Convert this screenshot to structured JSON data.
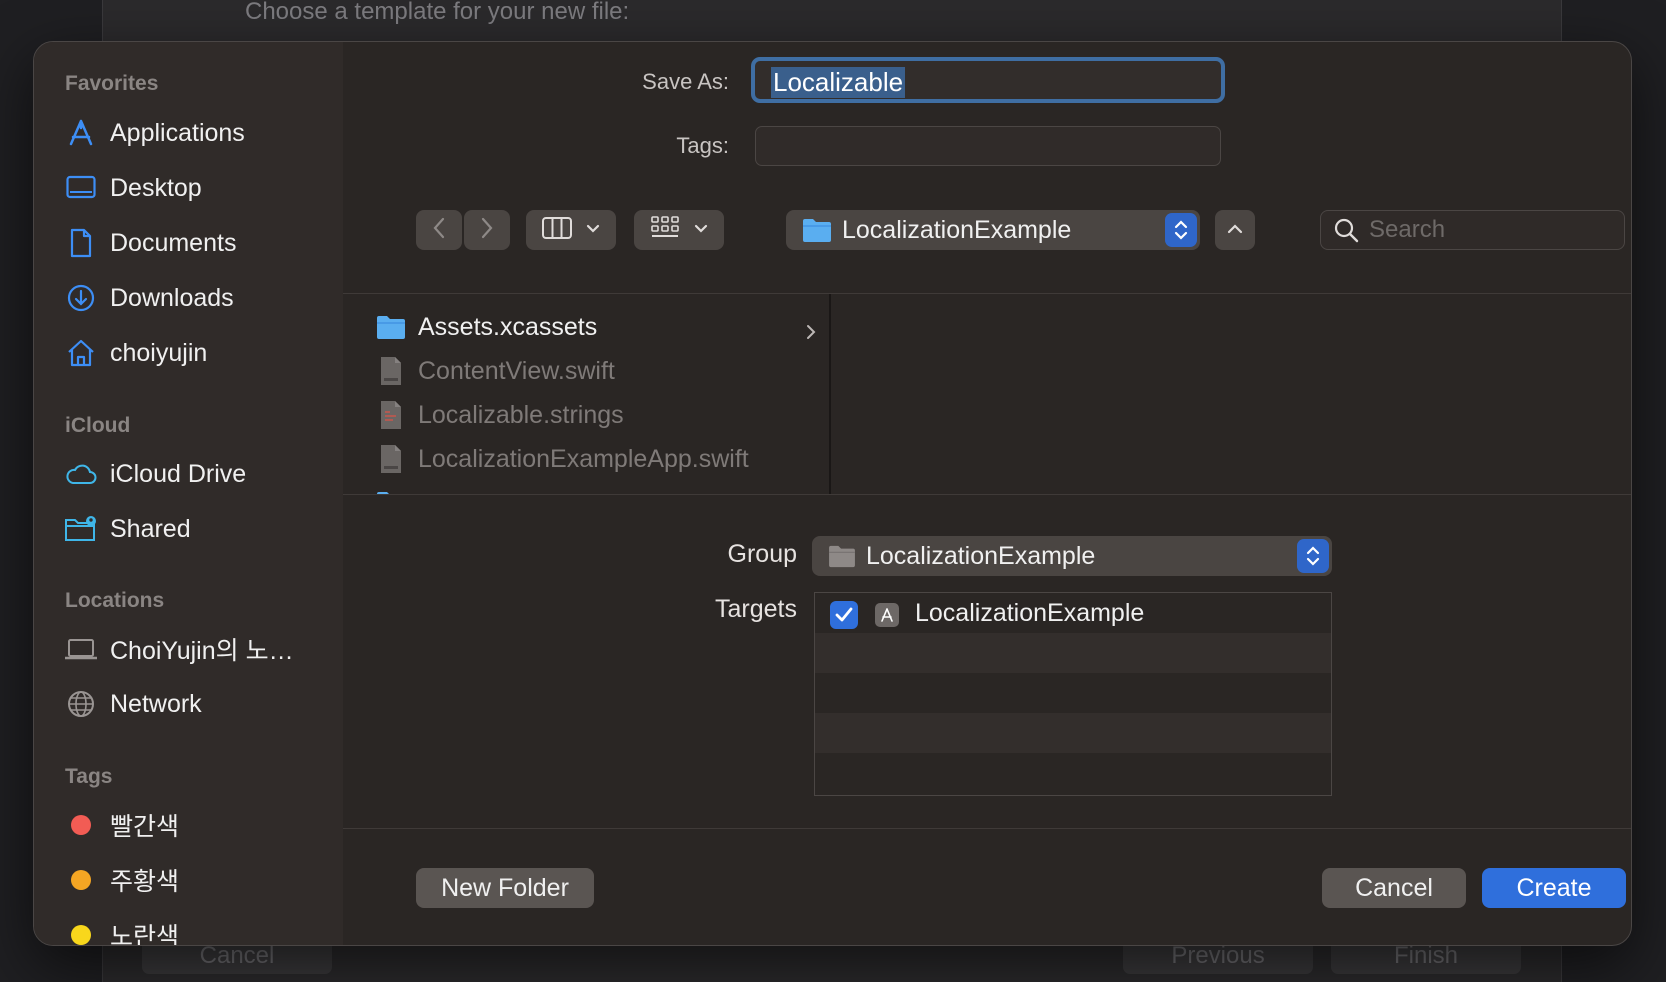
{
  "background": {
    "title": "Choose a template for your new file:",
    "cancel_label": "Cancel",
    "previous_label": "Previous",
    "finish_label": "Finish"
  },
  "sidebar": {
    "favorites_header": "Favorites",
    "favorites": [
      {
        "label": "Applications",
        "icon": "applications-icon"
      },
      {
        "label": "Desktop",
        "icon": "desktop-icon"
      },
      {
        "label": "Documents",
        "icon": "document-icon"
      },
      {
        "label": "Downloads",
        "icon": "download-icon"
      },
      {
        "label": "choiyujin",
        "icon": "home-icon"
      }
    ],
    "icloud_header": "iCloud",
    "icloud": [
      {
        "label": "iCloud Drive",
        "icon": "cloud-icon"
      },
      {
        "label": "Shared",
        "icon": "shared-folder-icon"
      }
    ],
    "locations_header": "Locations",
    "locations": [
      {
        "label": "ChoiYujin의 노…",
        "icon": "laptop-icon"
      },
      {
        "label": "Network",
        "icon": "globe-icon"
      }
    ],
    "tags_header": "Tags",
    "tags": [
      {
        "label": "빨간색",
        "color": "#f25c54"
      },
      {
        "label": "주황색",
        "color": "#f5a623"
      },
      {
        "label": "노란색",
        "color": "#f8d71c"
      }
    ]
  },
  "form": {
    "save_as_label": "Save As:",
    "save_as_value": "Localizable",
    "tags_label": "Tags:",
    "tags_value": ""
  },
  "toolbar": {
    "path_folder": "LocalizationExample",
    "search_placeholder": "Search"
  },
  "browser": {
    "files": [
      {
        "name": "Assets.xcassets",
        "type": "folder",
        "enabled": true
      },
      {
        "name": "ContentView.swift",
        "type": "swift",
        "enabled": false
      },
      {
        "name": "Localizable.strings",
        "type": "strings",
        "enabled": false
      },
      {
        "name": "LocalizationExampleApp.swift",
        "type": "swift",
        "enabled": false
      }
    ]
  },
  "options": {
    "group_label": "Group",
    "group_value": "LocalizationExample",
    "targets_label": "Targets",
    "targets": [
      {
        "name": "LocalizationExample",
        "checked": true
      }
    ]
  },
  "buttons": {
    "new_folder": "New Folder",
    "cancel": "Cancel",
    "create": "Create"
  },
  "colors": {
    "accent": "#2f6fdc",
    "focus_ring": "#3f6ea3",
    "folder": "#5aaef0"
  }
}
